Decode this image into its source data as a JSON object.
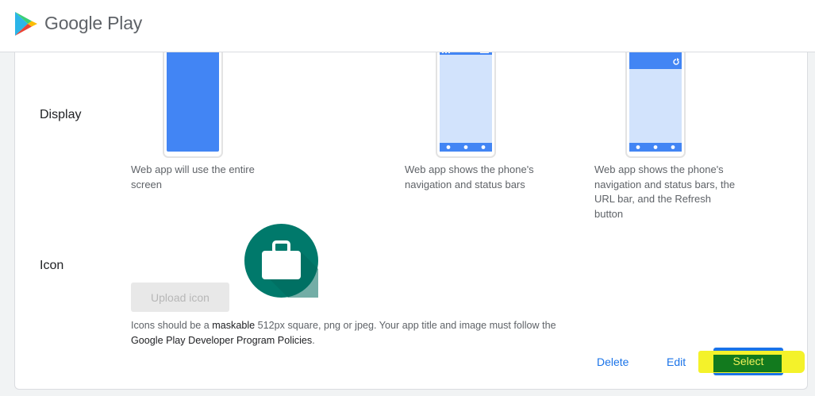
{
  "header": {
    "brand": "Google Play",
    "logo_icon": "google-play-logo-icon"
  },
  "display": {
    "label": "Display",
    "options": [
      {
        "phone_icon": "fullscreen-phone-icon",
        "caption": "Web app will use the entire screen"
      },
      {
        "phone_icon": "standalone-phone-icon",
        "caption": "Web app shows the phone's navigation and status bars"
      },
      {
        "phone_icon": "minimal-ui-phone-icon",
        "caption": "Web app shows the phone's navigation and status bars, the URL bar, and the Refresh button"
      }
    ]
  },
  "icon_section": {
    "label": "Icon",
    "preview_icon": "briefcase-icon",
    "upload_label": "Upload icon",
    "note_1": "Icons should be a ",
    "note_maskable": "maskable",
    "note_2": " 512px square, png or jpeg. Your app title and image must follow the ",
    "note_policy": "Google Play Developer Program Policies",
    "note_3": "."
  },
  "actions": {
    "delete_label": "Delete",
    "edit_label": "Edit",
    "select_label": "Select"
  },
  "colors": {
    "primary": "#1a73e8",
    "phone_fill": "#4285f4",
    "phone_light": "#d2e3fc",
    "icon_bg": "#00796b",
    "highlight_yellow": "#f4f22a",
    "highlight_green": "#127a1e"
  }
}
